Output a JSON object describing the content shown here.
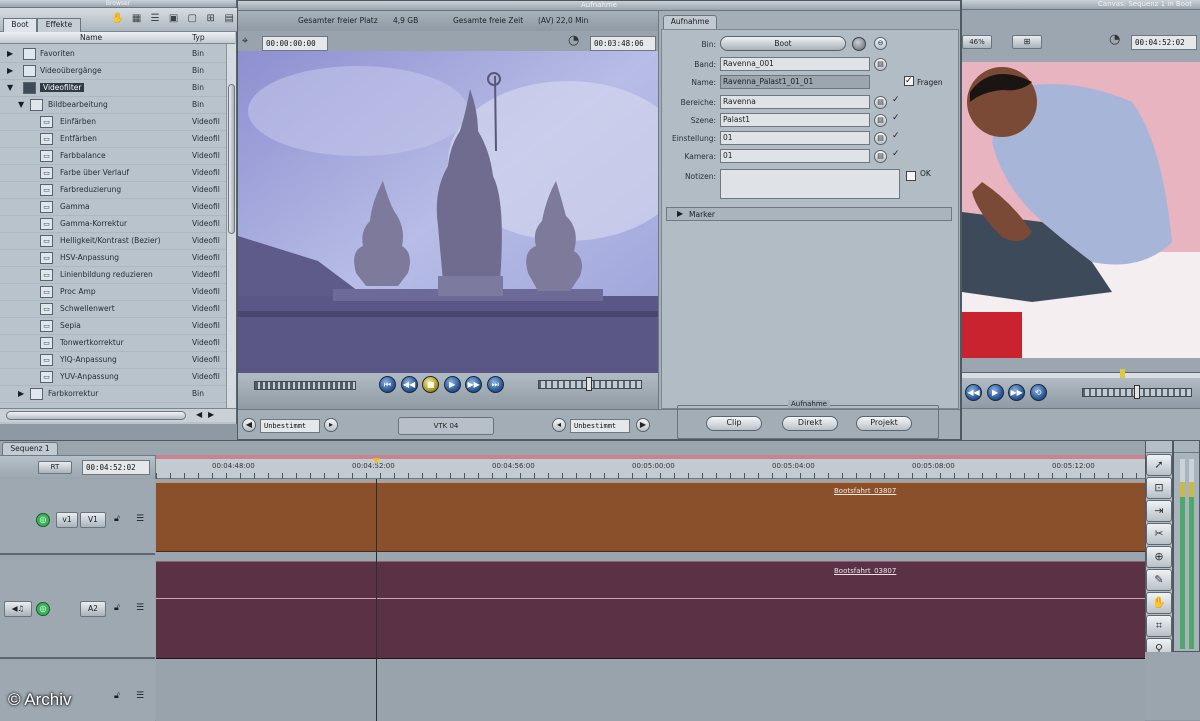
{
  "browser": {
    "title": "Browser",
    "tabs": [
      "Boot",
      "Effekte"
    ],
    "col_name": "Name",
    "col_type": "Typ",
    "items": [
      {
        "name": "Favoriten",
        "type": "Bin"
      },
      {
        "name": "Videoübergänge",
        "type": "Bin"
      },
      {
        "name": "Videofilter",
        "type": "Bin"
      },
      {
        "name": "Bildbearbeitung",
        "type": "Bin"
      },
      {
        "name": "Einfärben",
        "type": "Videofil"
      },
      {
        "name": "Entfärben",
        "type": "Videofil"
      },
      {
        "name": "Farbbalance",
        "type": "Videofil"
      },
      {
        "name": "Farbe über Verlauf",
        "type": "Videofil"
      },
      {
        "name": "Farbreduzierung",
        "type": "Videofil"
      },
      {
        "name": "Gamma",
        "type": "Videofil"
      },
      {
        "name": "Gamma-Korrektur",
        "type": "Videofil"
      },
      {
        "name": "Helligkeit/Kontrast (Bezier)",
        "type": "Videofil"
      },
      {
        "name": "HSV-Anpassung",
        "type": "Videofil"
      },
      {
        "name": "Linienbildung reduzieren",
        "type": "Videofil"
      },
      {
        "name": "Proc Amp",
        "type": "Videofil"
      },
      {
        "name": "Schwellenwert",
        "type": "Videofil"
      },
      {
        "name": "Sepia",
        "type": "Videofil"
      },
      {
        "name": "Tonwertkorrektur",
        "type": "Videofil"
      },
      {
        "name": "YIQ-Anpassung",
        "type": "Videofil"
      },
      {
        "name": "YUV-Anpassung",
        "type": "Videofil"
      },
      {
        "name": "Farbkorrektur",
        "type": "Bin"
      }
    ]
  },
  "capture": {
    "title": "Aufnahme",
    "free_space_label": "Gesamter freier Platz",
    "free_space_value": "4,9 GB",
    "free_time_label": "Gesamte freie Zeit",
    "free_time_value": "(AV) 22,0 Min",
    "timecode_in": "00:00:00:00",
    "timecode_dur": "00:03:48:06",
    "deck": "VTK 04",
    "unbestimmt_left": "Unbestimmt",
    "unbestimmt_right": "Unbestimmt"
  },
  "log_panel": {
    "tab": "Aufnahme",
    "bin_label": "Bin:",
    "bin_value": "Boot",
    "band_label": "Band:",
    "band_value": "Ravenna_001",
    "name_label": "Name:",
    "name_value": "Ravenna_Palast1_01_01",
    "fragen_label": "Fragen",
    "bereich_label": "Bereiche:",
    "bereich_value": "Ravenna",
    "szene_label": "Szene:",
    "szene_value": "Palast1",
    "einstellung_label": "Einstellung:",
    "einstellung_value": "01",
    "kamera_label": "Kamera:",
    "kamera_value": "01",
    "notizen_label": "Notizen:",
    "ok_label": "OK",
    "marker_label": "Marker",
    "aufnahme_group": "Aufnahme",
    "btn_clip": "Clip",
    "btn_direkt": "Direkt",
    "btn_projekt": "Projekt"
  },
  "canvas": {
    "title": "Canvas: Sequenz 1 in Boot",
    "timecode": "00:04:52:02",
    "zoom": "46%"
  },
  "timeline": {
    "tab": "Sequenz 1",
    "rt": "RT",
    "timecode": "00:04:52:02",
    "ruler": [
      "00:04:48:00",
      "00:04:52:00",
      "00:04:56:00",
      "00:05:00:00",
      "00:05:04:00",
      "00:05:08:00",
      "00:05:12:00"
    ],
    "v1_src": "v1",
    "v1_dst": "V1",
    "a2_dst": "A2",
    "clip_video": "Bootsfahrt_03807",
    "clip_audio": "Bootsfahrt_03807",
    "colors": {
      "video": "#8a4f2b",
      "audio": "#5b3146"
    }
  },
  "tools": [
    "arrow-icon",
    "select-icon",
    "edit-icon",
    "razor-icon",
    "zoom-icon",
    "crop-icon",
    "hand-icon",
    "pen-icon",
    "scale-icon",
    "magnify-icon"
  ],
  "credit": "© Archiv"
}
